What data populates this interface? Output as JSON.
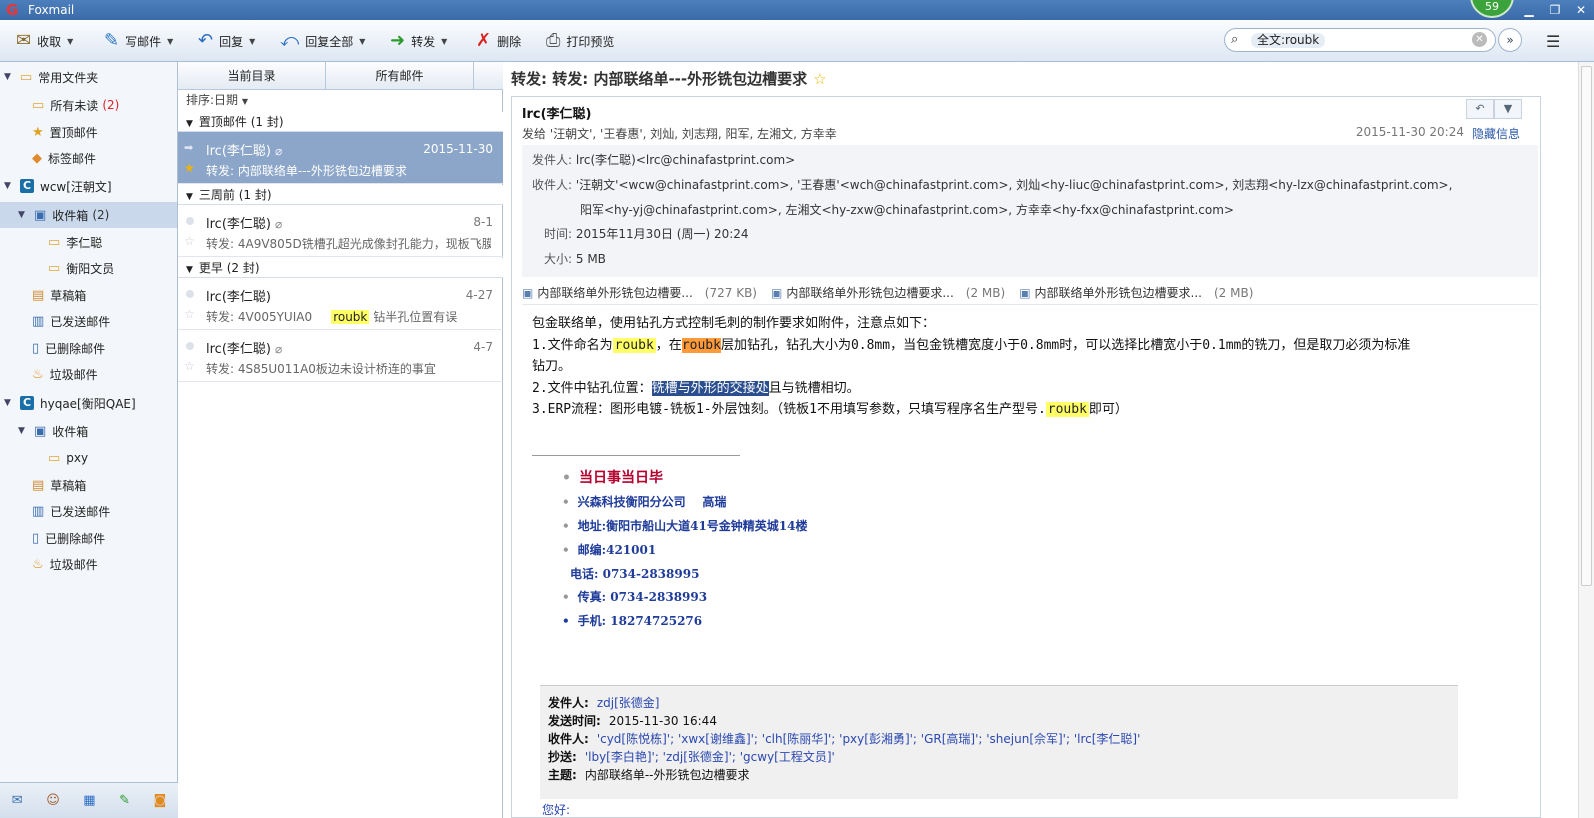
{
  "app": {
    "title": "Foxmail",
    "badge": "59"
  },
  "toolbar": {
    "receive": "收取",
    "compose": "写邮件",
    "reply": "回复",
    "reply_all": "回复全部",
    "forward": "转发",
    "delete": "删除",
    "print_preview": "打印预览"
  },
  "search": {
    "query": "全文:roubk"
  },
  "sidebar": {
    "common": "常用文件夹",
    "all_unread": "所有未读",
    "all_unread_count": "(2)",
    "pinned": "置顶邮件",
    "tagged": "标签邮件",
    "account1": "wcw[汪朝文]",
    "inbox1": "收件箱",
    "inbox1_count": "(2)",
    "sub1": "李仁聪",
    "sub2": "衡阳文员",
    "drafts1": "草稿箱",
    "sent1": "已发送邮件",
    "deleted1": "已删除邮件",
    "junk1": "垃圾邮件",
    "account2": "hyqae[衡阳QAE]",
    "inbox2": "收件箱",
    "sub3": "pxy",
    "drafts2": "草稿箱",
    "sent2": "已发送邮件",
    "deleted2": "已删除邮件",
    "junk2": "垃圾邮件"
  },
  "list": {
    "tab_current": "当前目录",
    "tab_all": "所有邮件",
    "sort": "排序:日期",
    "group1": "置顶邮件 (1 封)",
    "group2": "三周前 (1 封)",
    "group3": "更早 (2 封)",
    "messages": [
      {
        "from": "lrc(李仁聪)",
        "date": "2015-11-30",
        "subject": "转发: 内部联络单---外形铣包边槽要求"
      },
      {
        "from": "lrc(李仁聪)",
        "date": "8-1",
        "subject": "转发: 4A9V805D铣槽孔超光成像封孔能力，现板飞膜"
      },
      {
        "from": "lrc(李仁聪)",
        "date": "4-27",
        "subject_pre": "转发: 4V005YUIA0",
        "subject_hl": "roubk",
        "subject_post": "钻半孔位置有误"
      },
      {
        "from": "lrc(李仁聪)",
        "date": "4-7",
        "subject": "转发: 4S85U011A0板边未设计桥连的事宜"
      }
    ]
  },
  "mail": {
    "title": "转发: 转发: 内部联络单---外形铣包边槽要求",
    "sender": "lrc(李仁聪)",
    "sendto": "发给 '汪朝文', '王春惠', 刘灿, 刘志翔, 阳军, 左湘文, 方幸幸",
    "date": "2015-11-30 20:24",
    "hide_info": "隐藏信息",
    "from_label": "发件人:",
    "from_value": "lrc(李仁聪)<lrc@chinafastprint.com>",
    "to_label": "收件人:",
    "to_line1": "'汪朝文'<wcw@chinafastprint.com>, '王春惠'<wch@chinafastprint.com>, 刘灿<hy-liuc@chinafastprint.com>, 刘志翔<hy-lzx@chinafastprint.com>,",
    "to_line2": "阳军<hy-yj@chinafastprint.com>, 左湘文<hy-zxw@chinafastprint.com>, 方幸幸<hy-fxx@chinafastprint.com>",
    "time_label": "时间:",
    "time_value": "2015年11月30日 (周一) 20:24",
    "size_label": "大小:",
    "size_value": "5 MB",
    "attachments": [
      {
        "name": "内部联络单外形铣包边槽要...",
        "size": "(727 KB)"
      },
      {
        "name": "内部联络单外形铣包边槽要求...",
        "size": "(2 MB)"
      },
      {
        "name": "内部联络单外形铣包边槽要求...",
        "size": "(2 MB)"
      }
    ],
    "body": {
      "l1": "包金联络单，使用钻孔方式控制毛刺的制作要求如附件，注意点如下：",
      "l2a": "1.文件命名为",
      "l2b": "roubk",
      "l2c": "，在",
      "l2d": "roubk",
      "l2e": "层加钻孔，钻孔大小为0.8mm，当包金铣槽宽度小于0.8mm时，可以选择比槽宽小于0.1mm的铣刀，但是取刀必须为标准",
      "l3": "钻刀。",
      "l4a": "2.文件中钻孔位置：",
      "l4b": "铣槽与外形的交接处",
      "l4c": "且与铣槽相切。",
      "l5a": "3.ERP流程：图形电镀-铣板1-外层蚀刻。（铣板1不用填写参数，只填写程序名生产型号.",
      "l5b": "roubk",
      "l5c": "即可）"
    },
    "signature": {
      "motto": "当日事当日毕",
      "company": "兴森科技衡阳分公司",
      "name": "高瑞",
      "address": "地址:衡阳市船山大道41号金钟精英城14楼",
      "zip": "邮编:421001",
      "tel": "电话: 0734-2838995",
      "fax": "传真: 0734-2838993",
      "mobile": "手机: 18274725276"
    },
    "quote": {
      "from_label": "发件人:",
      "from_value": "zdj[张德金]",
      "time_label": "发送时间:",
      "time_value": "2015-11-30 16:44",
      "to_label": "收件人:",
      "to_value": "'cyd[陈悦栋]'; 'xwx[谢维鑫]'; 'clh[陈丽华]'; 'pxy[彭湘勇]'; 'GR[高瑞]'; 'shejun[佘军]'; 'lrc[李仁聪]'",
      "cc_label": "抄送:",
      "cc_value": "'lby[李白艳]'; 'zdj[张德金]'; 'gcwy[工程文员]'",
      "subj_label": "主题:",
      "subj_value": "内部联络单--外形铣包边槽要求"
    },
    "greeting": "您好:"
  }
}
